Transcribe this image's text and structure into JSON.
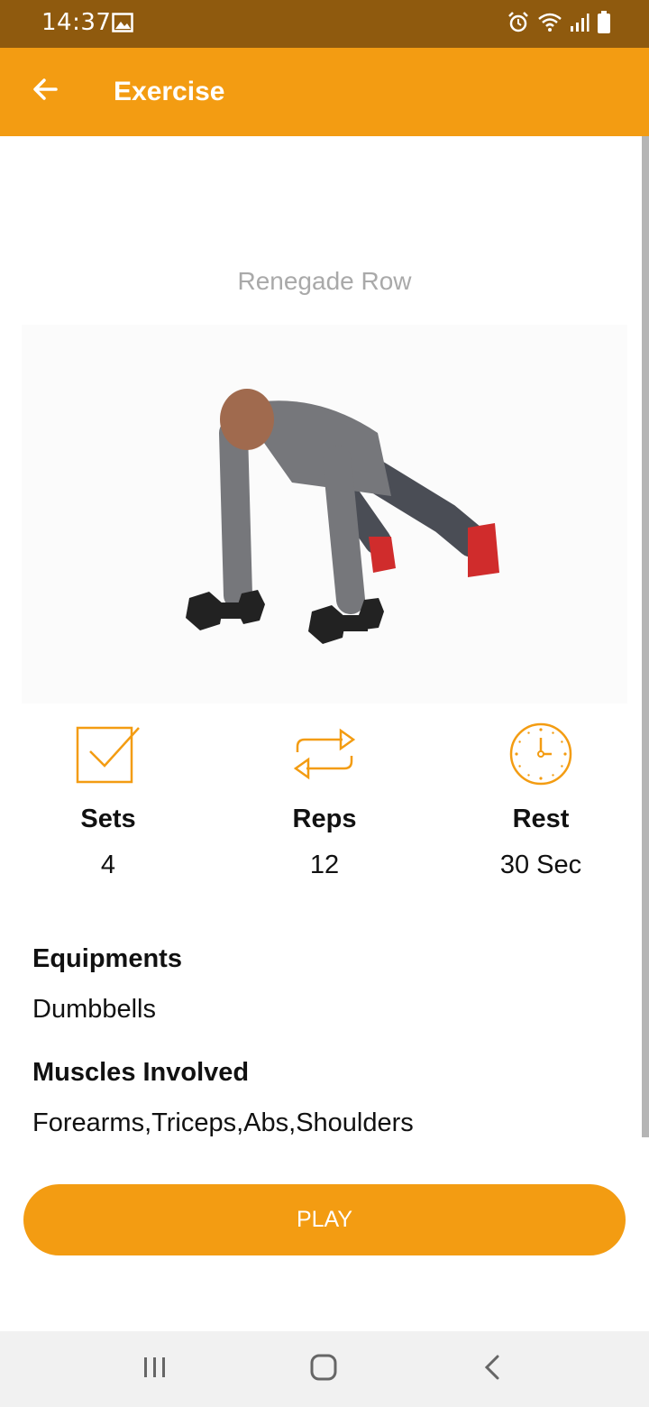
{
  "status_bar": {
    "time": "14:37",
    "icons": [
      "gallery-icon",
      "alarm-icon",
      "wifi-icon",
      "signal-icon",
      "battery-icon"
    ]
  },
  "app_bar": {
    "title": "Exercise",
    "back_icon": "arrow-left-icon"
  },
  "exercise": {
    "name": "Renegade Row",
    "image": "man-in-plank-position-holding-dumbbells"
  },
  "stats": [
    {
      "label": "Sets",
      "value": "4",
      "icon": "checkbox-icon"
    },
    {
      "label": "Reps",
      "value": "12",
      "icon": "repeat-icon"
    },
    {
      "label": "Rest",
      "value": "30 Sec",
      "icon": "clock-icon"
    }
  ],
  "details": {
    "equipments_heading": "Equipments",
    "equipments_value": "Dumbbells",
    "muscles_heading": "Muscles Involved",
    "muscles_value": "Forearms,Triceps,Abs,Shoulders"
  },
  "play_button": {
    "label": "PLAY"
  },
  "nav_bar": {
    "icons": [
      "recent-apps-icon",
      "home-icon",
      "back-icon"
    ]
  },
  "colors": {
    "status_bar": "#8f5a0e",
    "accent": "#f39c12",
    "muted_text": "#a9a9a9",
    "nav_bar": "#f1f1f1"
  }
}
